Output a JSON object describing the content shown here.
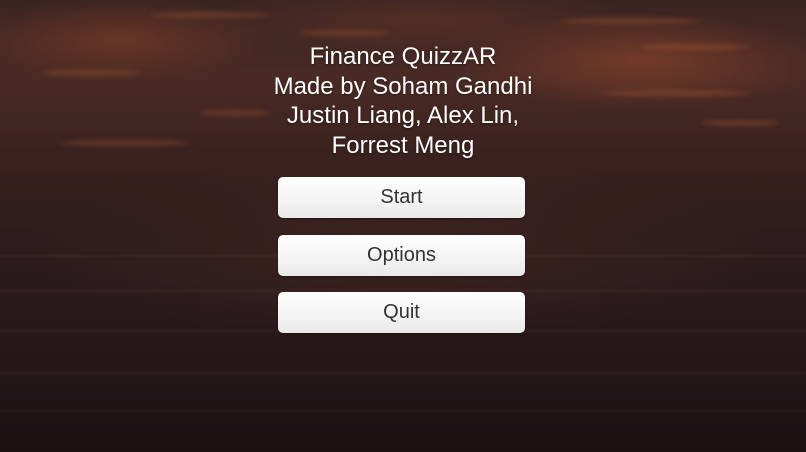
{
  "title": {
    "line1": "Finance QuizzAR",
    "line2": "Made by Soham Gandhi",
    "line3": "Justin Liang, Alex Lin,",
    "line4": "Forrest Meng"
  },
  "menu": {
    "start_label": "Start",
    "options_label": "Options",
    "quit_label": "Quit"
  },
  "colors": {
    "button_background": "#f4f4f4",
    "button_text": "#323232",
    "title_text": "#ffffff"
  }
}
